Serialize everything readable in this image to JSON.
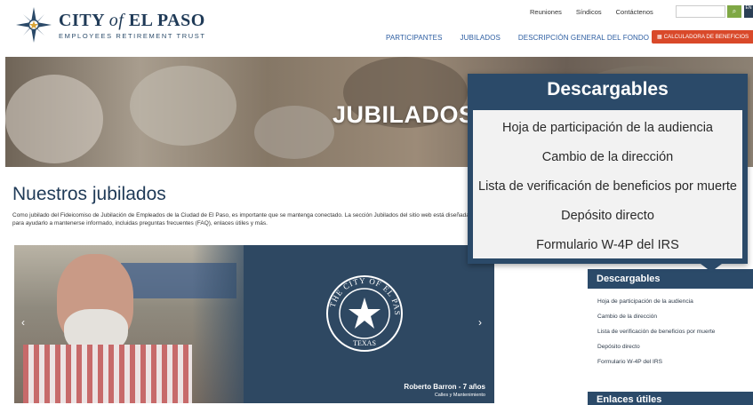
{
  "header": {
    "logo": {
      "title_prefix": "CITY",
      "title_of": "of",
      "title_suffix": "EL PASO",
      "subtitle": "EMPLOYEES RETIREMENT TRUST"
    },
    "util_nav": [
      "Reuniones",
      "Síndicos",
      "Contáctenos"
    ],
    "search_placeholder": "",
    "search_icon": "search-icon",
    "lang_label": "EN",
    "main_nav": [
      "PARTICIPANTES",
      "JUBILADOS",
      "DESCRIPCIÓN GENERAL DEL FONDO"
    ],
    "calc_button": "CALCULADORA DE BENEFICIOS",
    "colors": {
      "navy": "#1f3a57",
      "nav_blue": "#2c5da1",
      "accent": "#d9492a",
      "green": "#7fa845"
    }
  },
  "hero": {
    "title": "JUBILADOS"
  },
  "main": {
    "title": "Nuestros jubilados",
    "intro": "Como jubilado del Fideicomiso de Jubilación de Empleados de la Ciudad de El Paso, es importante que se mantenga conectado. La sección Jubilados del sitio web está diseñada para ayudarlo a mantenerse informado, incluidas preguntas frecuentes (FAQ), enlaces útiles y más."
  },
  "slider": {
    "prev": "‹",
    "next": "›",
    "seal_text": "THE CITY OF EL PASO",
    "seal_bottom": "TEXAS",
    "caption_name": "Roberto Barron - 7 años",
    "caption_dept": "Calles y Mantenimiento"
  },
  "sidebar": {
    "downloads_title": "Descargables",
    "downloads": [
      "Hoja de participación de la audiencia",
      "Cambio de la dirección",
      "Lista de verificación de beneficios por muerte",
      "Depósito directo",
      "Formulario W-4P del IRS"
    ],
    "links_title": "Enlaces útiles"
  },
  "callout": {
    "title": "Descargables",
    "items": [
      "Hoja de participación de la audiencia",
      "Cambio de la dirección",
      "Lista de verificación de beneficios por muerte",
      "Depósito directo",
      "Formulario W-4P del IRS"
    ]
  }
}
